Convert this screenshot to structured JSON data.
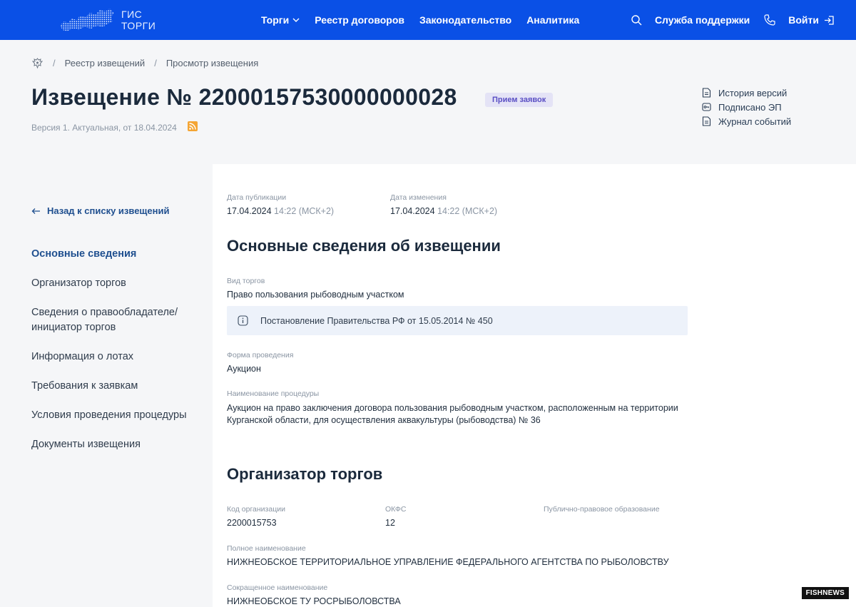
{
  "header": {
    "logo_line1": "ГИС",
    "logo_line2": "ТОРГИ",
    "nav": [
      "Торги",
      "Реестр договоров",
      "Законодательство",
      "Аналитика"
    ],
    "support": "Служба поддержки",
    "login": "Войти",
    "brand_color": "#0a50e6"
  },
  "breadcrumb": [
    "Реестр извещений",
    "Просмотр извещения"
  ],
  "title": "Извещение № 22000157530000000028",
  "status": "Прием заявок",
  "version": "Версия 1. Актуальная, от 18.04.2024",
  "side_links": [
    "История версий",
    "Подписано ЭП",
    "Журнал событий"
  ],
  "sidebar": {
    "back": "Назад к списку извещений",
    "items": [
      "Основные сведения",
      "Организатор торгов",
      "Сведения о правообладателе/ инициатор торгов",
      "Информация о лотах",
      "Требования к заявкам",
      "Условия проведения процедуры",
      "Документы извещения"
    ]
  },
  "meta": {
    "pub_label": "Дата публикации",
    "pub_date": "17.04.2024",
    "pub_time": "14:22 (МСК+2)",
    "mod_label": "Дата изменения",
    "mod_date": "17.04.2024",
    "mod_time": "14:22 (МСК+2)"
  },
  "section1": {
    "title": "Основные сведения об извещении",
    "kind_label": "Вид торгов",
    "kind_value": "Право пользования рыбоводным участком",
    "info": "Постановление Правительства РФ от 15.05.2014 № 450",
    "form_label": "Форма проведения",
    "form_value": "Аукцион",
    "name_label": "Наименование процедуры",
    "name_value": "Аукцион на право заключения договора пользования рыбоводным участком, расположенным на территории Курганской области, для осуществления аквакультуры (рыбоводства) № 36"
  },
  "section2": {
    "title": "Организатор торгов",
    "code_label": "Код организации",
    "code_value": "2200015753",
    "okfs_label": "ОКФС",
    "okfs_value": "12",
    "ppo_label": "Публично-правовое образование",
    "full_label": "Полное наименование",
    "full_value": "НИЖНЕОБСКОЕ ТЕРРИТОРИАЛЬНОЕ УПРАВЛЕНИЕ ФЕДЕРАЛЬНОГО АГЕНТСТВА ПО РЫБОЛОВСТВУ",
    "short_label": "Сокращенное наименование",
    "short_value": "НИЖНЕОБСКОЕ ТУ РОСРЫБОЛОВСТВА"
  },
  "watermark": "FISHNEWS"
}
